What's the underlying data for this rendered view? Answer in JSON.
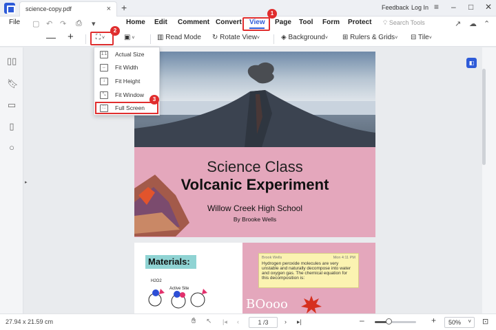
{
  "titlebar": {
    "tab_title": "science-copy.pdf",
    "tab_close": "×",
    "new_tab": "+",
    "feedback": "Feedback",
    "login": "Log In"
  },
  "menubar": {
    "file": "File",
    "items": [
      "Home",
      "Edit",
      "Comment",
      "Convert",
      "View",
      "Page",
      "Tool",
      "Form",
      "Protect"
    ],
    "search_placeholder": "Search Tools"
  },
  "toolbar": {
    "read_mode": "Read Mode",
    "rotate_view": "Rotate View",
    "background": "Background",
    "rulers_grids": "Rulers & Grids",
    "tile": "Tile"
  },
  "zoom_menu": {
    "items": [
      "Actual Size",
      "Fit Width",
      "Fit Height",
      "Fit Window",
      "Full Screen"
    ]
  },
  "badges": [
    "1",
    "2",
    "3"
  ],
  "document": {
    "title_line1": "Science Class",
    "title_line2": "Volcanic Experiment",
    "school": "Willow Creek High School",
    "author": "By Brooke Wells",
    "materials": "Materials:",
    "sketch_label1": "H2O2",
    "sketch_label2": "Active Site",
    "note_author": "Brook Wells",
    "note_time": "Mon 4:11 PM",
    "note_text": "Hydrogen peroxide molecules are very unstable and naturally decompose into water and oxygen gas. The chemical equation for this decomposition is:",
    "sound_text": "BOooo"
  },
  "statusbar": {
    "page_size": "27.94 x 21.59 cm",
    "page_indicator": "1 /3",
    "zoom": "50%"
  },
  "colors": {
    "accent": "#2e5bd8",
    "highlight": "#e02d2d",
    "pink": "#e4a7bc"
  }
}
